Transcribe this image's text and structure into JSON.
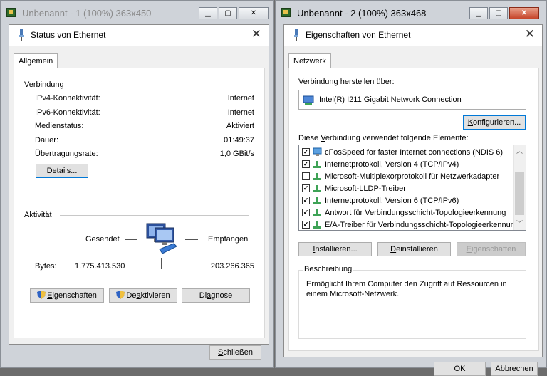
{
  "left_viewer": {
    "title": "Unbenannt - 1 (100%) 363x450"
  },
  "right_viewer": {
    "title": "Unbenannt - 2 (100%) 363x468"
  },
  "status_dialog": {
    "title": "Status von Ethernet",
    "tab": "Allgemein",
    "connection_group": "Verbindung",
    "rows": [
      {
        "label": "IPv4-Konnektivität:",
        "value": "Internet"
      },
      {
        "label": "IPv6-Konnektivität:",
        "value": "Internet"
      },
      {
        "label": "Medienstatus:",
        "value": "Aktiviert"
      },
      {
        "label": "Dauer:",
        "value": "01:49:37"
      },
      {
        "label": "Übertragungsrate:",
        "value": "1,0 GBit/s"
      }
    ],
    "details_button": {
      "pre": "",
      "ul": "D",
      "post": "etails..."
    },
    "activity_group": "Aktivität",
    "sent_label": "Gesendet",
    "received_label": "Empfangen",
    "bytes_label": "Bytes:",
    "bytes_sent": "1.775.413.530",
    "bytes_received": "203.266.365",
    "properties_button": {
      "pre": "",
      "ul": "E",
      "post": "igenschaften"
    },
    "deactivate_button": {
      "pre": "De",
      "ul": "a",
      "post": "ktivieren"
    },
    "diagnose_button": {
      "pre": "Di",
      "ul": "a",
      "post": "gnose"
    },
    "close_button": {
      "pre": "",
      "ul": "S",
      "post": "chließen"
    }
  },
  "props_dialog": {
    "title": "Eigenschaften von Ethernet",
    "tab": "Netzwerk",
    "connect_using_label": "Verbindung herstellen über:",
    "adapter_name": "Intel(R) I211 Gigabit Network Connection",
    "configure_button": {
      "pre": "",
      "ul": "K",
      "post": "onfigurieren..."
    },
    "items_label": {
      "pre": "Diese ",
      "ul": "V",
      "post": "erbindung verwendet folgende Elemente:"
    },
    "items": [
      {
        "label": "cFosSpeed for faster Internet connections (NDIS 6)",
        "checked": true,
        "icon": "network-client-icon"
      },
      {
        "label": "Internetprotokoll, Version 4 (TCP/IPv4)",
        "checked": true,
        "icon": "protocol-icon"
      },
      {
        "label": "Microsoft-Multiplexorprotokoll für Netzwerkadapter",
        "checked": false,
        "icon": "protocol-icon"
      },
      {
        "label": "Microsoft-LLDP-Treiber",
        "checked": true,
        "icon": "protocol-icon"
      },
      {
        "label": "Internetprotokoll, Version 6 (TCP/IPv6)",
        "checked": true,
        "icon": "protocol-icon"
      },
      {
        "label": "Antwort für Verbindungsschicht-Topologieerkennung",
        "checked": true,
        "icon": "protocol-icon"
      },
      {
        "label": "E/A-Treiber für Verbindungsschicht-Topologieerkennun",
        "checked": true,
        "icon": "protocol-icon"
      }
    ],
    "install_button": {
      "pre": "",
      "ul": "I",
      "post": "nstallieren..."
    },
    "uninstall_button": {
      "pre": "",
      "ul": "D",
      "post": "einstallieren"
    },
    "properties_button": {
      "pre": "",
      "ul": "E",
      "post": "igenschaften"
    },
    "description_label": "Beschreibung",
    "description_text_line1": "Ermöglicht Ihrem Computer den Zugriff auf Ressourcen in",
    "description_text_line2": "einem Microsoft-Netzwerk.",
    "ok_button": "OK",
    "cancel_button": "Abbrechen"
  }
}
